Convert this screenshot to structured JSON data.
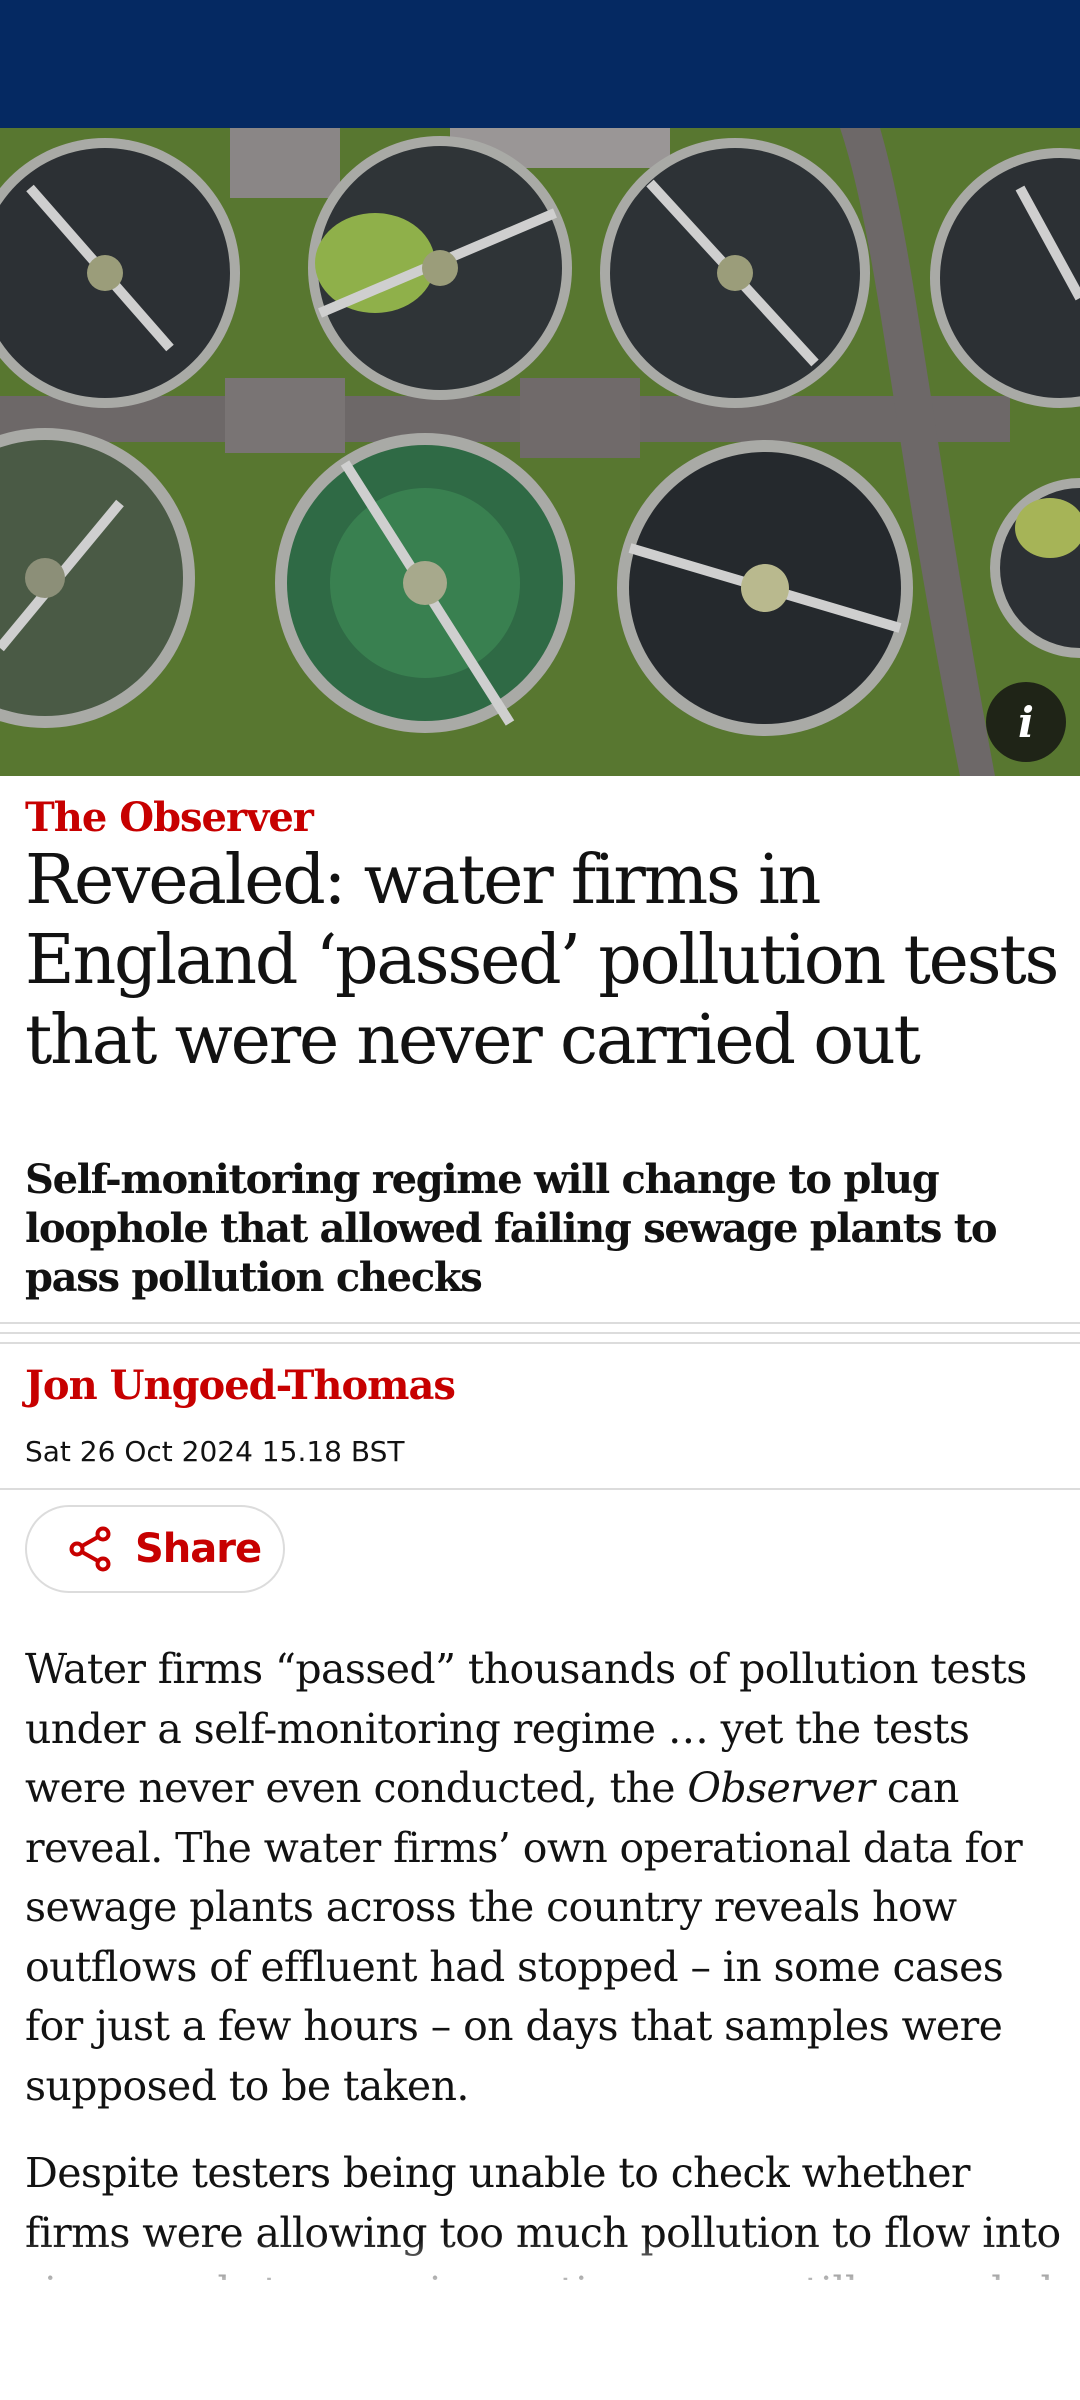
{
  "colors": {
    "masthead": "#052962",
    "accent_red": "#c70000",
    "text": "#121212",
    "divider": "#dcdcdc"
  },
  "hero": {
    "info_icon": "info-icon",
    "info_glyph": "i"
  },
  "article": {
    "series": "The Observer",
    "headline": "Revealed: water firms in England ‘passed’ pollution tests that were never carried out",
    "standfirst": "Self-monitoring regime will change to plug loophole that allowed failing sewage plants to pass pollution checks",
    "author": "Jon Ungoed-Thomas",
    "date": "Sat 26 Oct 2024 15.18 BST",
    "share": {
      "label": "Share",
      "icon": "share-icon"
    },
    "paragraph1": {
      "part1": "Water firms “passed” thousands of pollution tests under a self-monitoring regime … yet the tests were never even conducted, the ",
      "emphasis": "Observer",
      "part2": " can reveal. The water firms’ own operational data for sewage plants across the country reveals how outflows of effluent had stopped – in some cases for just a few hours – on days that samples were supposed to be taken."
    },
    "paragraph2": "Despite testers being unable to check whether firms were allowing too much pollution to flow into rivers and streams, inspections were still recorded as a pass, allowing the"
  }
}
